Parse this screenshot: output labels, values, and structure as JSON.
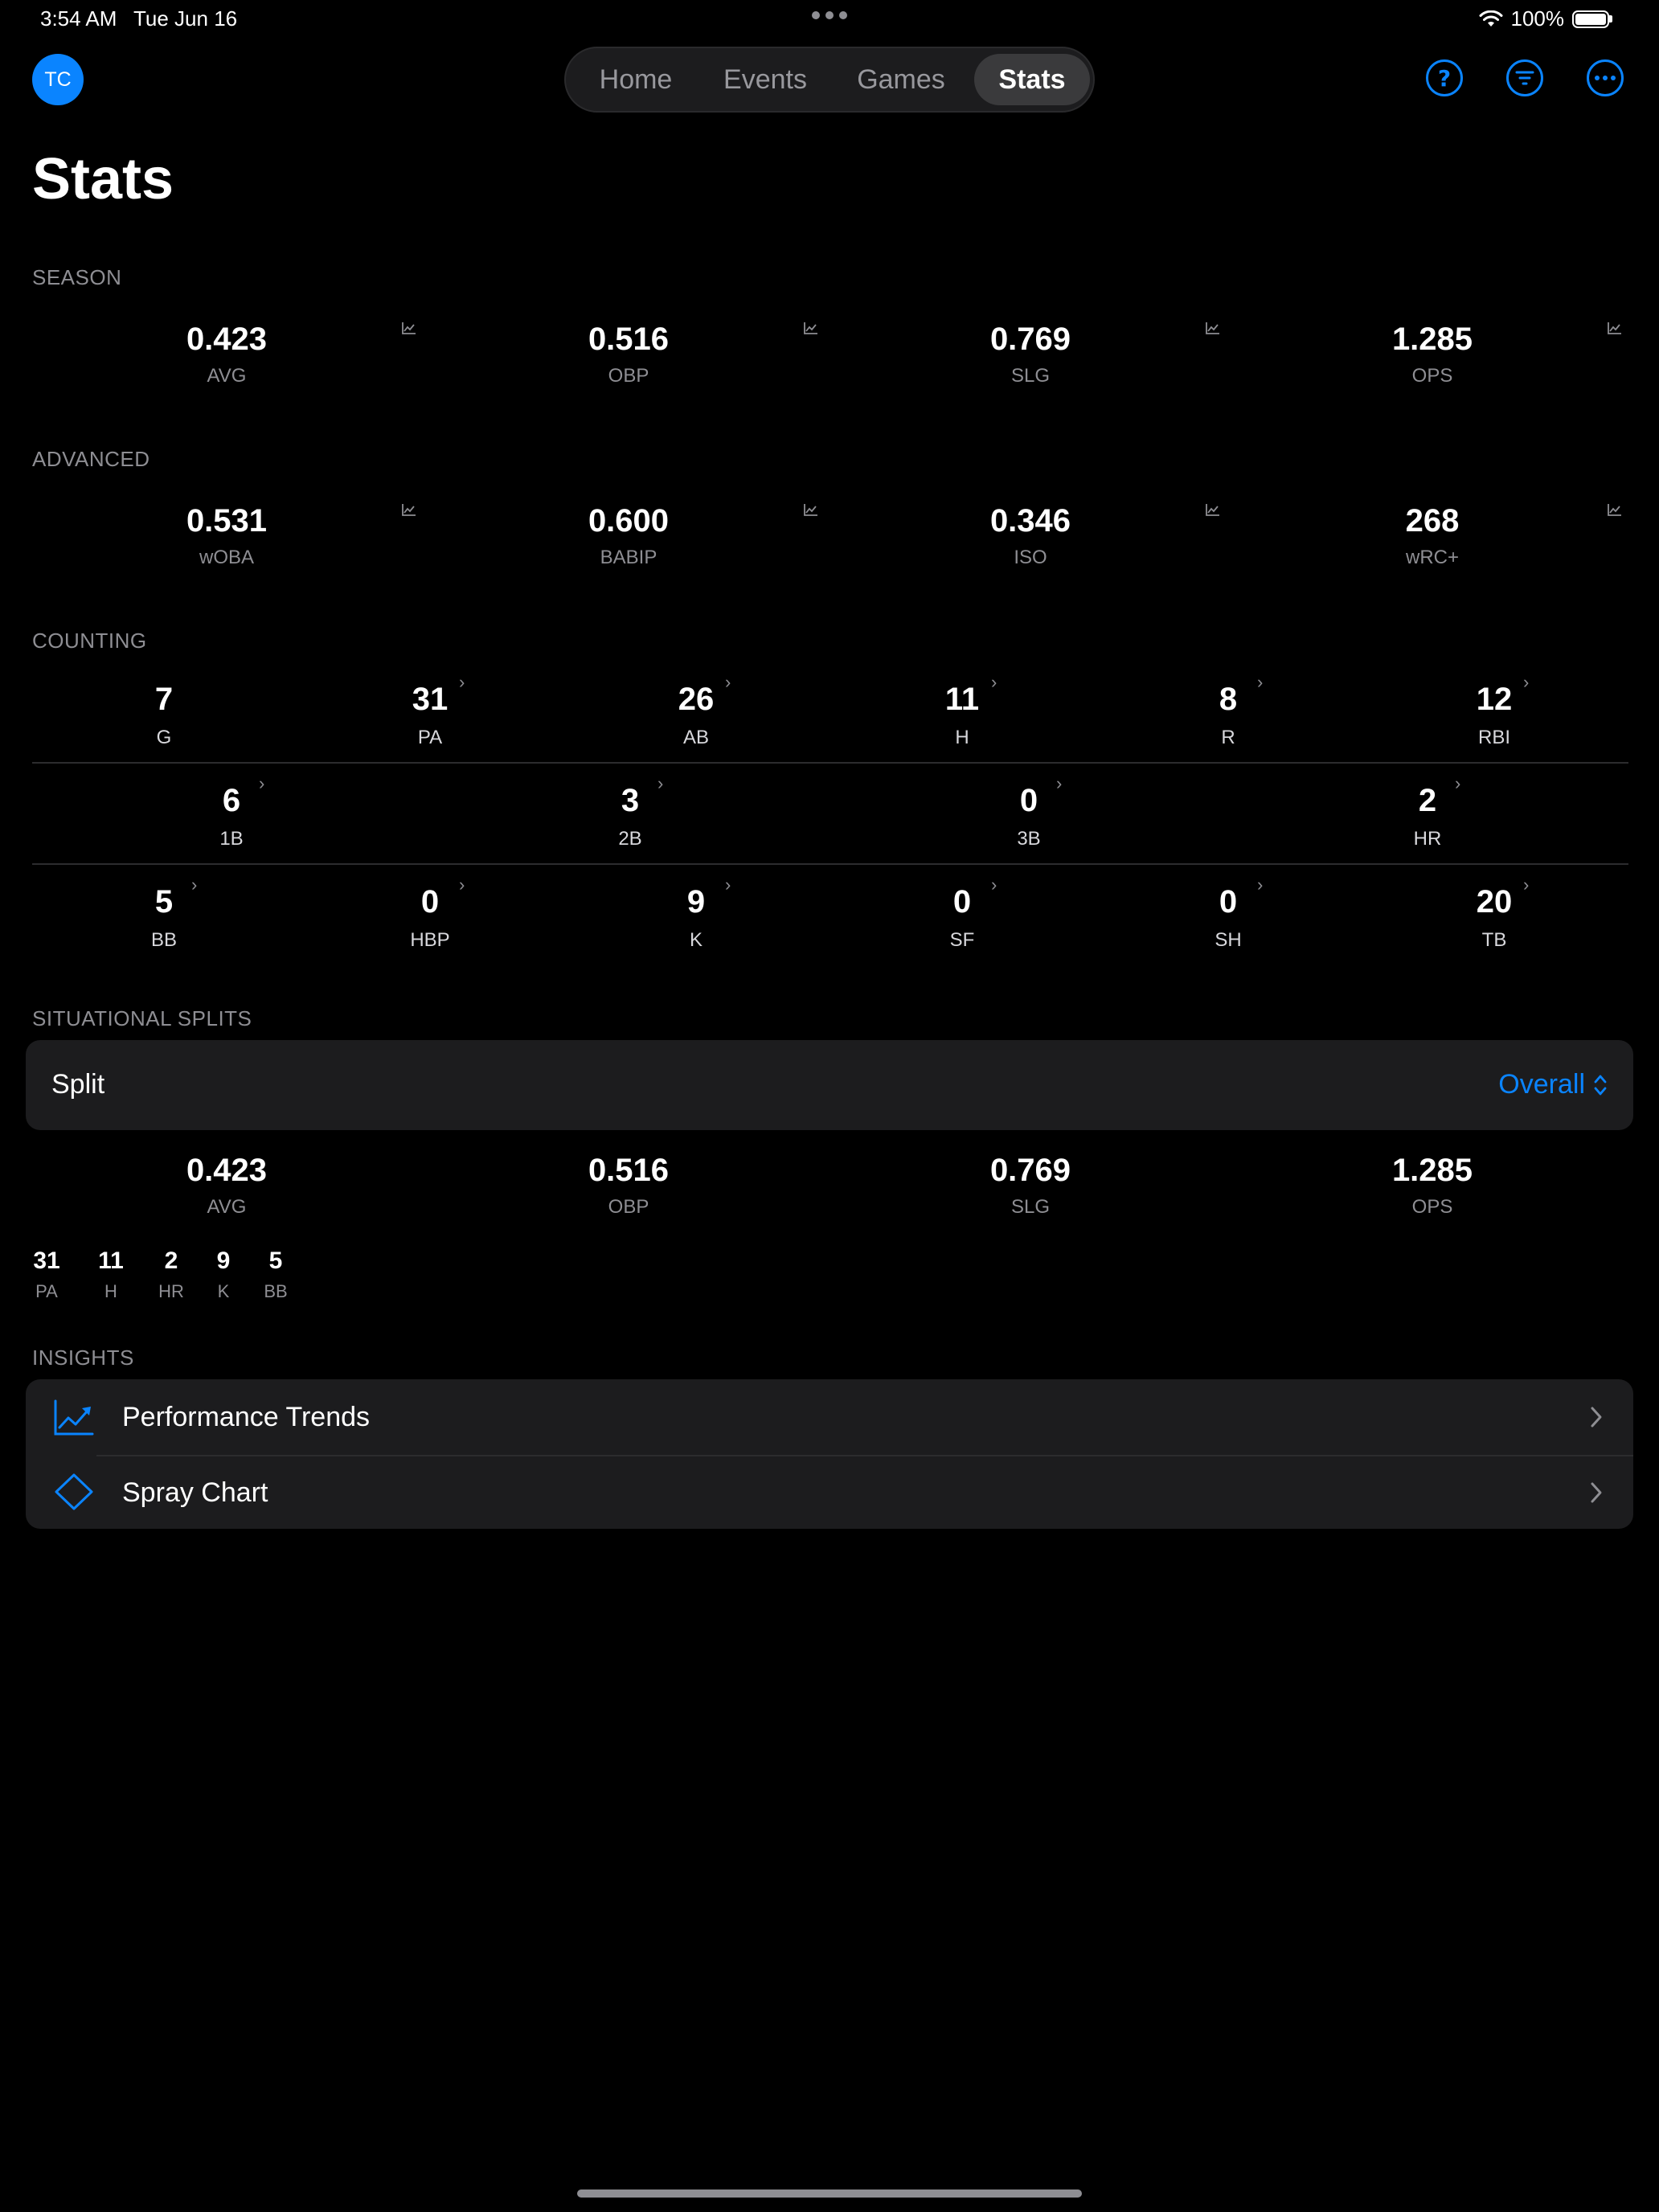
{
  "status_bar": {
    "time": "3:54 AM",
    "date": "Tue Jun 16",
    "battery": "100%"
  },
  "header": {
    "avatar_initials": "TC",
    "tabs": [
      {
        "label": "Home",
        "active": false
      },
      {
        "label": "Events",
        "active": false
      },
      {
        "label": "Games",
        "active": false
      },
      {
        "label": "Stats",
        "active": true
      }
    ],
    "icons": [
      "help-icon",
      "filter-icon",
      "more-icon"
    ]
  },
  "page_title": "Stats",
  "season": {
    "label": "SEASON",
    "stats": [
      {
        "value": "0.423",
        "label": "AVG"
      },
      {
        "value": "0.516",
        "label": "OBP"
      },
      {
        "value": "0.769",
        "label": "SLG"
      },
      {
        "value": "1.285",
        "label": "OPS"
      }
    ]
  },
  "advanced": {
    "label": "ADVANCED",
    "stats": [
      {
        "value": "0.531",
        "label": "wOBA"
      },
      {
        "value": "0.600",
        "label": "BABIP"
      },
      {
        "value": "0.346",
        "label": "ISO"
      },
      {
        "value": "268",
        "label": "wRC+"
      }
    ]
  },
  "counting": {
    "label": "COUNTING",
    "row1": [
      {
        "value": "7",
        "label": "G"
      },
      {
        "value": "31",
        "label": "PA"
      },
      {
        "value": "26",
        "label": "AB"
      },
      {
        "value": "11",
        "label": "H"
      },
      {
        "value": "8",
        "label": "R"
      },
      {
        "value": "12",
        "label": "RBI"
      }
    ],
    "row2": [
      {
        "value": "6",
        "label": "1B"
      },
      {
        "value": "3",
        "label": "2B"
      },
      {
        "value": "0",
        "label": "3B"
      },
      {
        "value": "2",
        "label": "HR"
      }
    ],
    "row3": [
      {
        "value": "5",
        "label": "BB"
      },
      {
        "value": "0",
        "label": "HBP"
      },
      {
        "value": "9",
        "label": "K"
      },
      {
        "value": "0",
        "label": "SF"
      },
      {
        "value": "0",
        "label": "SH"
      },
      {
        "value": "20",
        "label": "TB"
      }
    ]
  },
  "situational": {
    "label": "SITUATIONAL SPLITS",
    "split_label": "Split",
    "split_value": "Overall",
    "stats": [
      {
        "value": "0.423",
        "label": "AVG"
      },
      {
        "value": "0.516",
        "label": "OBP"
      },
      {
        "value": "0.769",
        "label": "SLG"
      },
      {
        "value": "1.285",
        "label": "OPS"
      }
    ],
    "mini": [
      {
        "value": "31",
        "label": "PA"
      },
      {
        "value": "11",
        "label": "H"
      },
      {
        "value": "2",
        "label": "HR"
      },
      {
        "value": "9",
        "label": "K"
      },
      {
        "value": "5",
        "label": "BB"
      }
    ]
  },
  "insights": {
    "label": "INSIGHTS",
    "items": [
      {
        "label": "Performance Trends",
        "icon": "trend-chart-icon"
      },
      {
        "label": "Spray Chart",
        "icon": "diamond-icon"
      }
    ]
  },
  "colors": {
    "accent": "#0a84ff",
    "background": "#000000",
    "card": "#1c1c1e"
  }
}
